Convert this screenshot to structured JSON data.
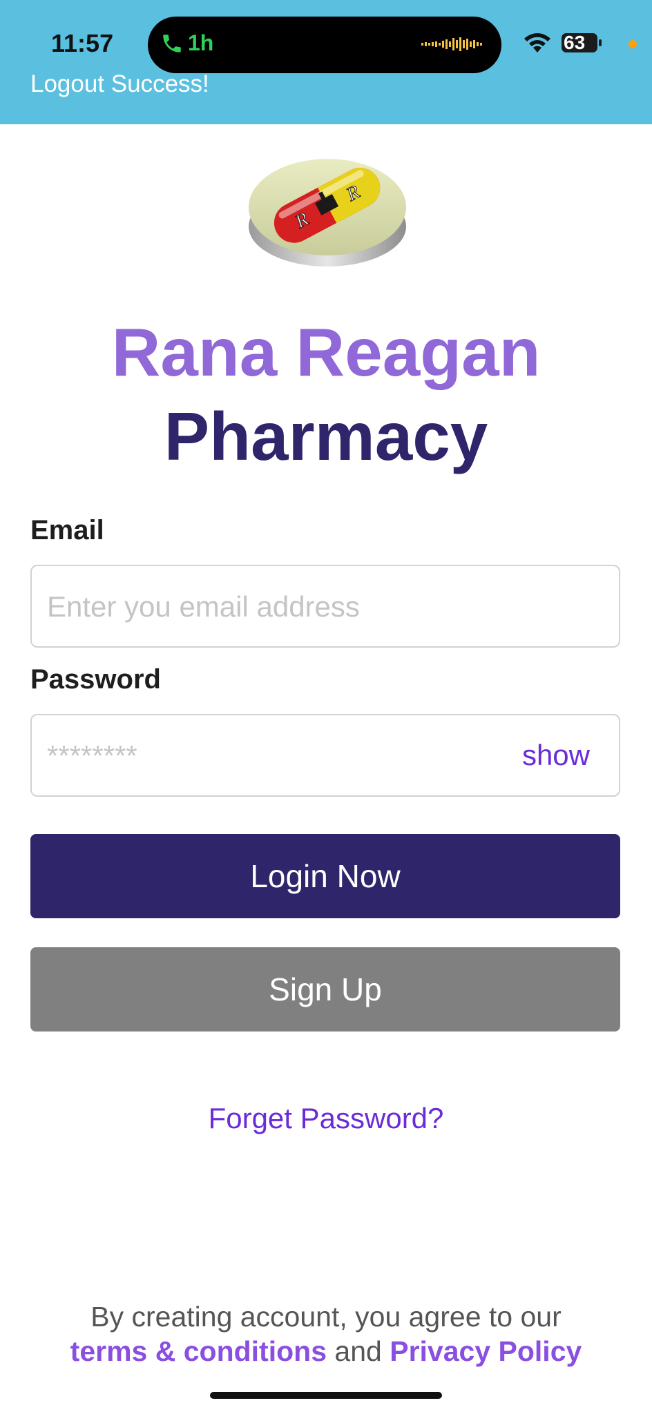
{
  "status_bar": {
    "time": "11:57",
    "call_duration": "1h",
    "battery": "63"
  },
  "toast": {
    "message": "Logout Success!"
  },
  "brand": {
    "title_line1": "Rana Reagan",
    "title_line2": "Pharmacy"
  },
  "form": {
    "email_label": "Email",
    "email_placeholder": "Enter you email address",
    "email_value": "",
    "password_label": "Password",
    "password_placeholder": "********",
    "password_value": "",
    "show_label": "show"
  },
  "actions": {
    "login_label": "Login Now",
    "signup_label": "Sign Up",
    "forgot_label": "Forget Password?"
  },
  "footer": {
    "agreement_text": "By creating account, you agree to our",
    "terms_label": "terms & conditions",
    "and_text": "and",
    "privacy_label": "Privacy Policy"
  },
  "colors": {
    "header_bg": "#5bbfdf",
    "brand_light": "#9168d8",
    "brand_dark": "#2f256b",
    "link": "#6a2bd9",
    "signup_bg": "#808080"
  },
  "icons": {
    "call": "phone-icon",
    "waveform": "waveform-icon",
    "wifi": "wifi-icon",
    "battery": "battery-icon",
    "logo": "pill-logo"
  }
}
